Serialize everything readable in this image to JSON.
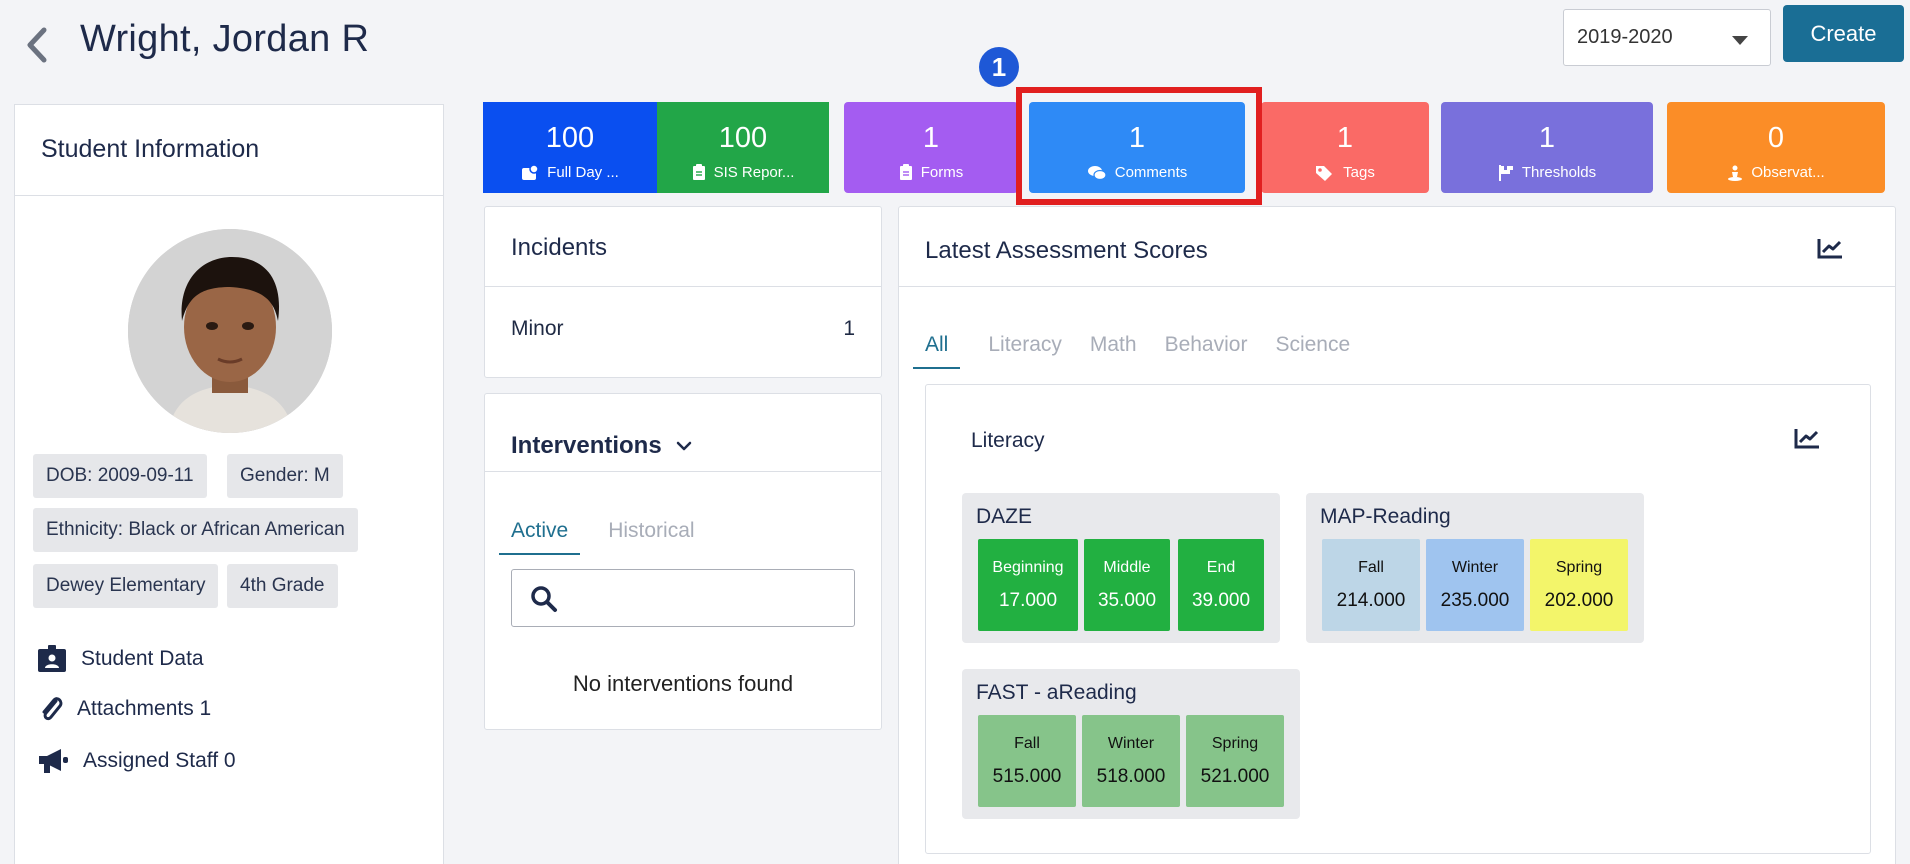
{
  "header": {
    "student_name": "Wright, Jordan R",
    "year_select_value": "2019-2020",
    "create_label": "Create"
  },
  "student_info": {
    "title": "Student Information",
    "dob": "DOB: 2009-09-11",
    "gender": "Gender: M",
    "ethnicity": "Ethnicity: Black or African American",
    "school": "Dewey Elementary",
    "grade": "4th Grade",
    "links": {
      "student_data": "Student Data",
      "attachments": "Attachments 1",
      "assigned_staff": "Assigned Staff 0"
    }
  },
  "tiles": [
    {
      "count": "100",
      "label": "Full Day ...",
      "color": "#0a4ff0",
      "icon": "attendance-icon"
    },
    {
      "count": "100",
      "label": "SIS Repor...",
      "color": "#22a648",
      "icon": "clipboard-icon"
    },
    {
      "count": "1",
      "label": "Forms",
      "color": "#a45cf1",
      "icon": "clipboard-icon"
    },
    {
      "count": "1",
      "label": "Comments",
      "color": "#2e8af6",
      "icon": "comments-icon"
    },
    {
      "count": "1",
      "label": "Tags",
      "color": "#fa6a66",
      "icon": "tags-icon"
    },
    {
      "count": "1",
      "label": "Thresholds",
      "color": "#7970dc",
      "icon": "flag-icon"
    },
    {
      "count": "0",
      "label": "Observat...",
      "color": "#fb8d27",
      "icon": "observation-icon"
    }
  ],
  "annotation": {
    "step_number": "1",
    "highlight_color": "#e11f1f"
  },
  "incidents": {
    "title": "Incidents",
    "rows": [
      {
        "label": "Minor",
        "count": "1"
      }
    ]
  },
  "interventions": {
    "title": "Interventions",
    "tabs": [
      "Active",
      "Historical"
    ],
    "active_tab": "Active",
    "search_value": "",
    "empty_text": "No interventions found"
  },
  "assessments": {
    "title": "Latest Assessment Scores",
    "tabs": [
      "All",
      "Literacy",
      "Math",
      "Behavior",
      "Science"
    ],
    "active_tab": "All",
    "subject": "Literacy",
    "groups": [
      {
        "name": "DAZE",
        "scores": [
          {
            "period": "Beginning",
            "value": "17.000",
            "color": "#22b041"
          },
          {
            "period": "Middle",
            "value": "35.000",
            "color": "#22b041"
          },
          {
            "period": "End",
            "value": "39.000",
            "color": "#22b041"
          }
        ]
      },
      {
        "name": "MAP-Reading",
        "scores": [
          {
            "period": "Fall",
            "value": "214.000",
            "color": "#bdd6e7"
          },
          {
            "period": "Winter",
            "value": "235.000",
            "color": "#9fc4ef"
          },
          {
            "period": "Spring",
            "value": "202.000",
            "color": "#f3f56a"
          }
        ]
      },
      {
        "name": "FAST - aReading",
        "scores": [
          {
            "period": "Fall",
            "value": "515.000",
            "color": "#86c48a"
          },
          {
            "period": "Winter",
            "value": "518.000",
            "color": "#86c48a"
          },
          {
            "period": "Spring",
            "value": "521.000",
            "color": "#86c48a"
          }
        ]
      }
    ]
  }
}
